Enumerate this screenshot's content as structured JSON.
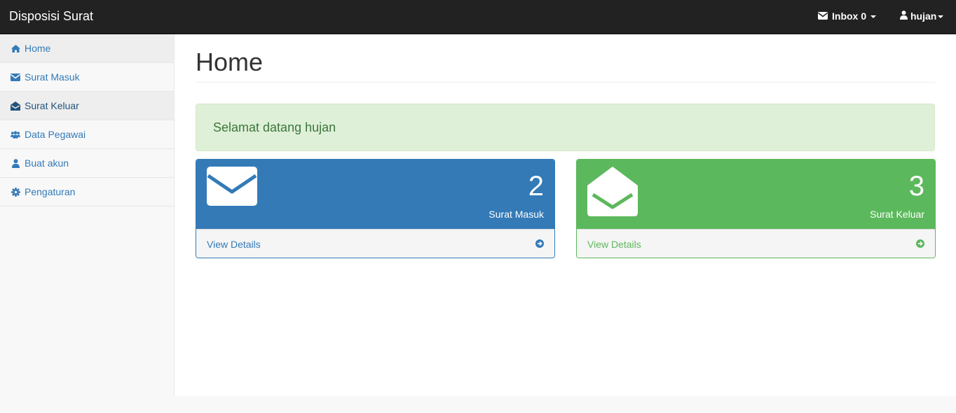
{
  "navbar": {
    "brand": "Disposisi Surat",
    "inbox_label": "Inbox",
    "inbox_count": "0",
    "user_label": "hujan"
  },
  "sidebar": {
    "items": [
      {
        "label": "Home",
        "icon": "home-icon"
      },
      {
        "label": "Surat Masuk",
        "icon": "envelope-icon"
      },
      {
        "label": "Surat Keluar",
        "icon": "envelope-open-icon"
      },
      {
        "label": "Data Pegawai",
        "icon": "users-icon"
      },
      {
        "label": "Buat akun",
        "icon": "user-icon"
      },
      {
        "label": "Pengaturan",
        "icon": "gear-icon"
      }
    ]
  },
  "main": {
    "title": "Home",
    "welcome": "Selamat datang hujan",
    "panels": [
      {
        "count": "2",
        "label": "Surat Masuk",
        "footer": "View Details",
        "icon": "envelope-icon",
        "color": "#337ab7"
      },
      {
        "count": "3",
        "label": "Surat Keluar",
        "footer": "View Details",
        "icon": "envelope-open-icon",
        "color": "#5cb85c"
      }
    ]
  },
  "colors": {
    "navbar": "#222222",
    "primary": "#337ab7",
    "success": "#5cb85c",
    "alert_bg": "#dff0d8",
    "alert_text": "#3c763d"
  }
}
